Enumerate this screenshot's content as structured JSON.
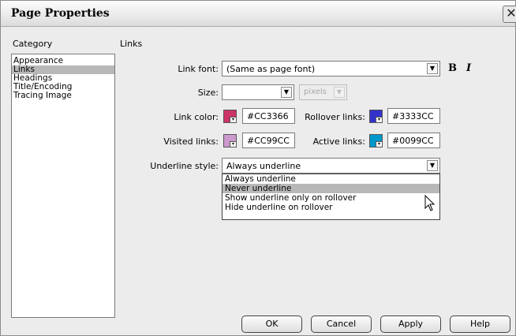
{
  "window": {
    "title": "Page Properties",
    "close_glyph": "✕"
  },
  "category": {
    "label": "Category",
    "items": [
      "Appearance",
      "Links",
      "Headings",
      "Title/Encoding",
      "Tracing Image"
    ],
    "selected": "Links"
  },
  "section_title": "Links",
  "link_font": {
    "label": "Link font:",
    "value": "(Same as page font)",
    "bold_label": "B",
    "italic_label": "I"
  },
  "size": {
    "label": "Size:",
    "value": "",
    "unit": "pixels"
  },
  "colors": {
    "link": {
      "label": "Link color:",
      "value": "#CC3366"
    },
    "rollover": {
      "label": "Rollover links:",
      "value": "#3333CC"
    },
    "visited": {
      "label": "Visited links:",
      "value": "#CC99CC"
    },
    "active": {
      "label": "Active links:",
      "value": "#0099CC"
    }
  },
  "underline": {
    "label": "Underline style:",
    "value": "Always underline",
    "options": [
      "Always underline",
      "Never underline",
      "Show underline only on rollover",
      "Hide underline on rollover"
    ],
    "highlighted": "Never underline"
  },
  "buttons": {
    "ok": "OK",
    "cancel": "Cancel",
    "apply": "Apply",
    "help": "Help"
  }
}
